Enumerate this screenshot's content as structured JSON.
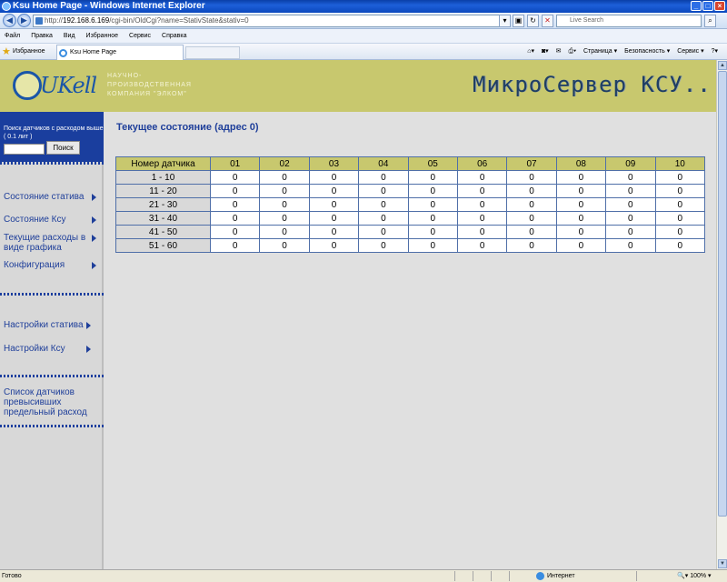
{
  "window": {
    "title": "Ksu Home Page - Windows Internet Explorer"
  },
  "address": {
    "url_prefix": "http://",
    "url_host": "192.168.6.169",
    "url_rest": "/cgi-bin/OldCgi?name=StativState&stativ=0",
    "live_search_placeholder": "Live Search"
  },
  "menu": [
    "Файл",
    "Правка",
    "Вид",
    "Избранное",
    "Сервис",
    "Справка"
  ],
  "favorites": {
    "label": "Избранное",
    "tab_title": "Ksu Home Page",
    "commands": [
      "Страница ▾",
      "Безопасность ▾",
      "Сервис ▾"
    ]
  },
  "header": {
    "logo_text": "UKell",
    "company_lines": [
      "научно-",
      "производственная",
      "компания  \"элком\""
    ],
    "brand": "МикроСервер КСУ.."
  },
  "sidebar": {
    "search_label": "Поиск датчиков с расходом выше ( 0.1 лит )",
    "search_button": "Поиск",
    "items": [
      "Состояние статива",
      "Состояние Ксу",
      "Текущие расходы в виде графика",
      "Конфигурация",
      "Настройки статива",
      "Настройки Ксу",
      "Список датчиков превысивших предельный расход"
    ]
  },
  "main": {
    "title": "Текущее состояние (адрес 0)",
    "table": {
      "headers": [
        "Номер датчика",
        "01",
        "02",
        "03",
        "04",
        "05",
        "06",
        "07",
        "08",
        "09",
        "10"
      ],
      "rows": [
        {
          "label": "1 - 10",
          "values": [
            "0",
            "0",
            "0",
            "0",
            "0",
            "0",
            "0",
            "0",
            "0",
            "0"
          ]
        },
        {
          "label": "11 - 20",
          "values": [
            "0",
            "0",
            "0",
            "0",
            "0",
            "0",
            "0",
            "0",
            "0",
            "0"
          ]
        },
        {
          "label": "21 - 30",
          "values": [
            "0",
            "0",
            "0",
            "0",
            "0",
            "0",
            "0",
            "0",
            "0",
            "0"
          ]
        },
        {
          "label": "31 - 40",
          "values": [
            "0",
            "0",
            "0",
            "0",
            "0",
            "0",
            "0",
            "0",
            "0",
            "0"
          ]
        },
        {
          "label": "41 - 50",
          "values": [
            "0",
            "0",
            "0",
            "0",
            "0",
            "0",
            "0",
            "0",
            "0",
            "0"
          ]
        },
        {
          "label": "51 - 60",
          "values": [
            "0",
            "0",
            "0",
            "0",
            "0",
            "0",
            "0",
            "0",
            "0",
            "0"
          ]
        }
      ]
    }
  },
  "status": {
    "left": "Готово",
    "zone": "Интернет",
    "zoom": "100%"
  }
}
